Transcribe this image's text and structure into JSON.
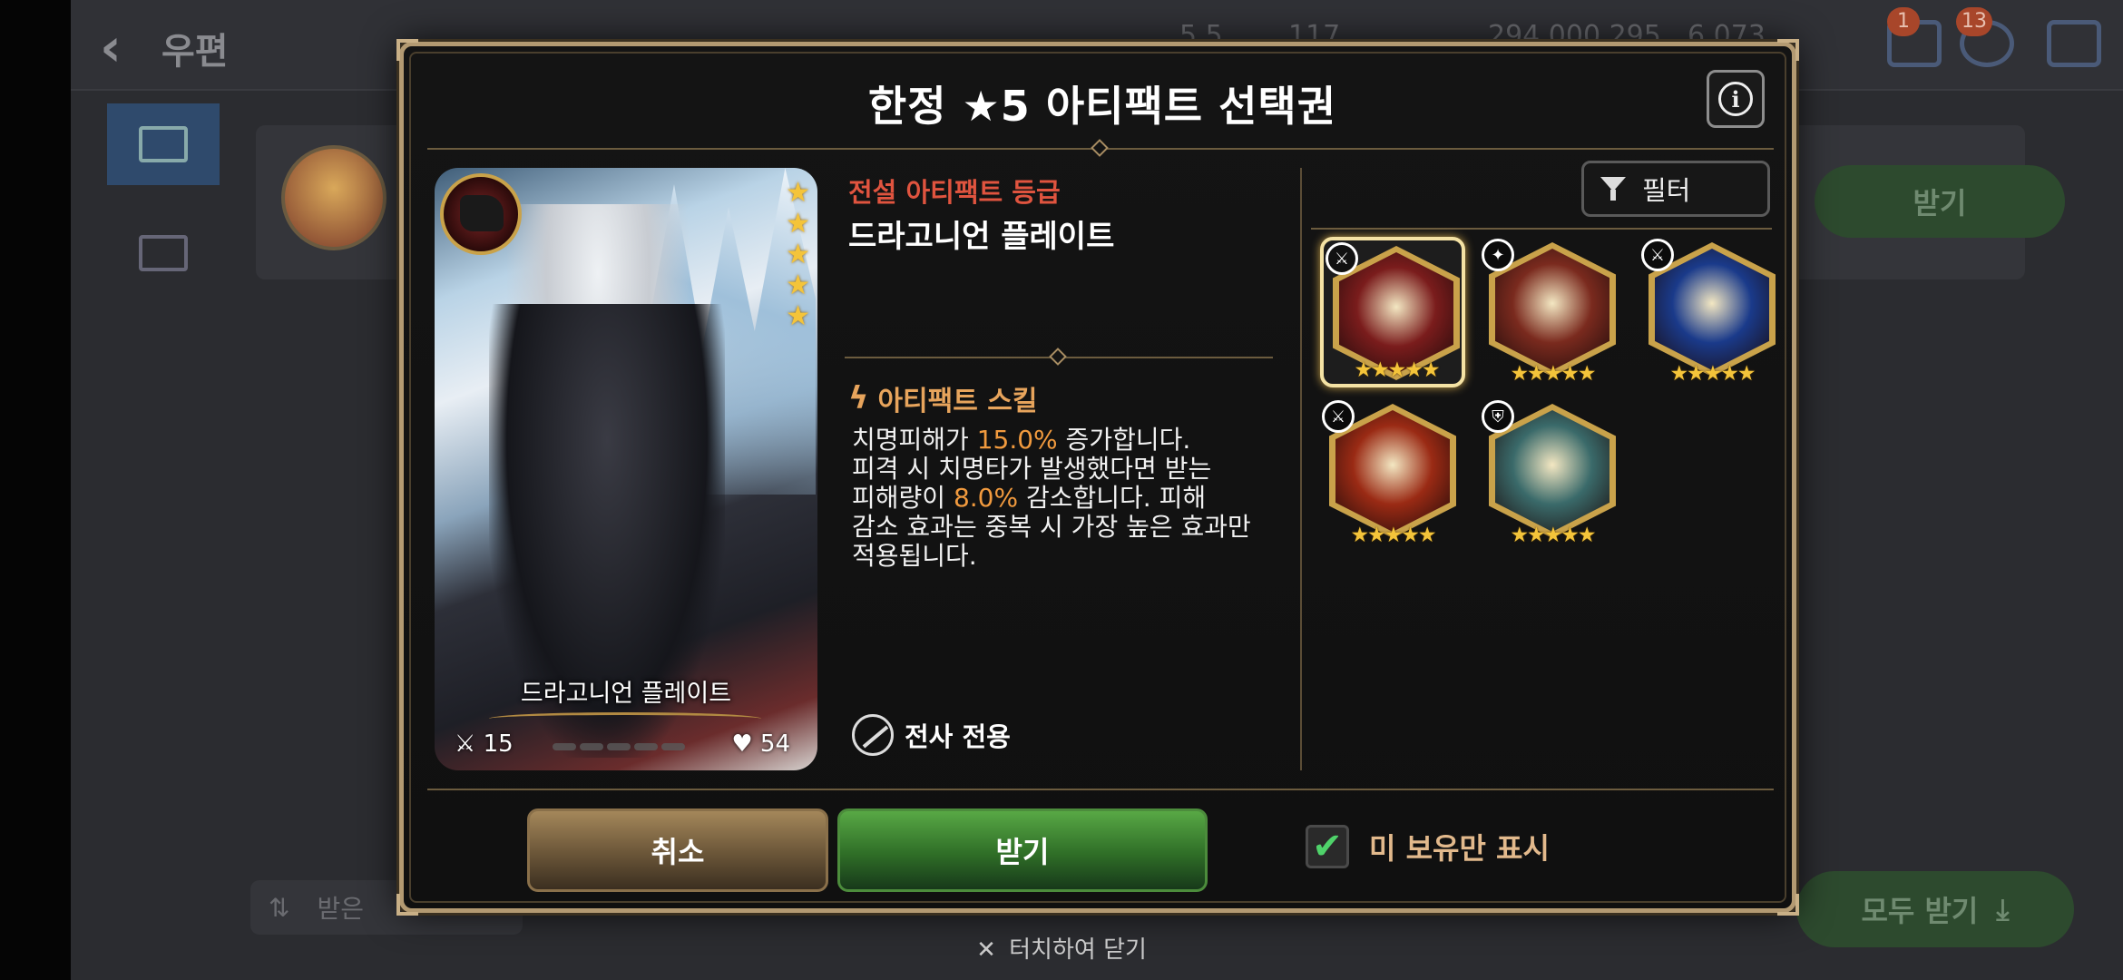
{
  "background": {
    "back_glyph": "‹",
    "screen_title": "우편",
    "resources": [
      "5,5",
      "117",
      "294,000,295",
      "6,073"
    ],
    "mail_badge": "1",
    "chat_badge": "13",
    "receive_label": "받기",
    "receive_all_label": "모두 받기",
    "sort_label": "받은"
  },
  "modal": {
    "title": "한정 ★5 아티팩트 선택권",
    "info_glyph": "i",
    "grade": "전설 아티팩트 등급",
    "artifact_name": "드라고니언 플레이트",
    "card": {
      "name": "드라고니언 플레이트",
      "attack": "15",
      "health": "54",
      "stars": 5
    },
    "skill_title": "아티팩트 스킬",
    "skill_desc": {
      "p1": "치명피해가 ",
      "v1": "15.0%",
      "p2": " 증가합니다.",
      "p3": "피격 시 치명타가 발생했다면 받는",
      "p4": "피해량이 ",
      "v2": "8.0%",
      "p5": " 감소합니다. 피해",
      "p6": "감소 효과는 중복 시 가장 높은 효과만",
      "p7": "적용됩니다."
    },
    "class_label": "전사 전용",
    "filter_label": "필터",
    "artifacts": [
      {
        "name": "artifact-dragonian-plate",
        "stars": "★★★★★",
        "selected": true,
        "bg": "#7a1c1c",
        "cls": "⚔"
      },
      {
        "name": "artifact-bubble-wand",
        "stars": "★★★★★",
        "selected": false,
        "bg": "#7a2a1e",
        "cls": "✦"
      },
      {
        "name": "artifact-blue-star",
        "stars": "★★★★★",
        "selected": false,
        "bg": "#1a3a8a",
        "cls": "⚔"
      },
      {
        "name": "artifact-golden-globe",
        "stars": "★★★★★",
        "selected": false,
        "bg": "#9a2a14",
        "cls": "⚔"
      },
      {
        "name": "artifact-sunglasses",
        "stars": "★★★★★",
        "selected": false,
        "bg": "#3a6a6a",
        "cls": "⛨"
      }
    ],
    "cancel_label": "취소",
    "receive_label": "받기",
    "owned_check": "✔",
    "owned_label": "미 보유만 표시"
  },
  "close_hint": {
    "x": "✕",
    "label": "터치하여 닫기"
  }
}
